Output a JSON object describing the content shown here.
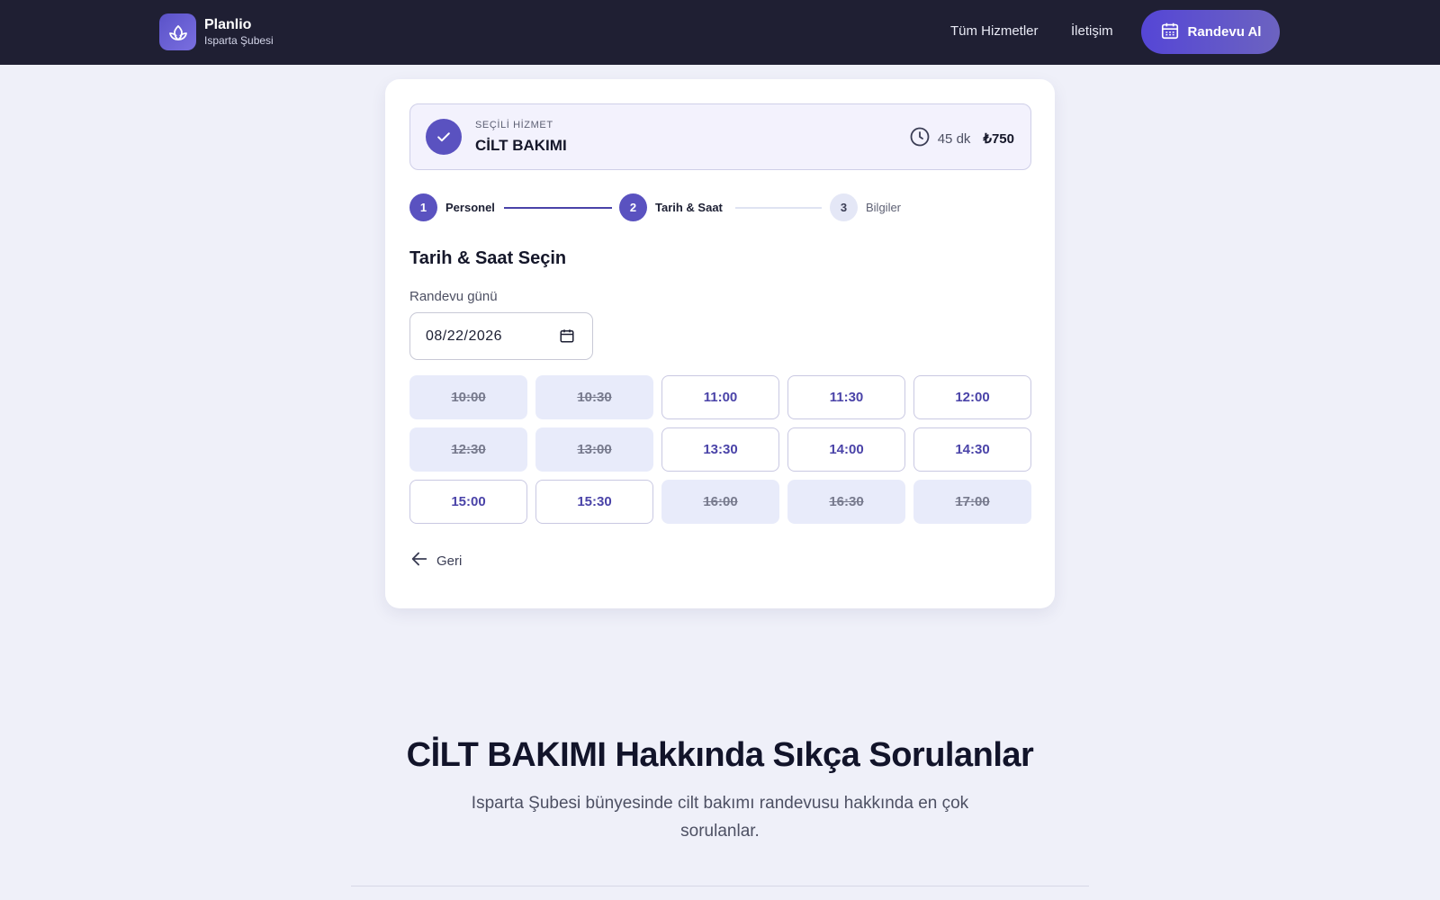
{
  "header": {
    "brand_name": "Planlio",
    "brand_sub": "Isparta Şubesi",
    "nav": [
      "Tüm Hizmetler",
      "İletişim"
    ],
    "cta_label": "Randevu Al"
  },
  "service": {
    "label": "SEÇİLİ HİZMET",
    "name": "CİLT BAKIMI",
    "duration": "45 dk",
    "price": "₺750"
  },
  "steps": [
    {
      "num": "1",
      "label": "Personel",
      "state": "done"
    },
    {
      "num": "2",
      "label": "Tarih & Saat",
      "state": "active"
    },
    {
      "num": "3",
      "label": "Bilgiler",
      "state": "upcoming"
    }
  ],
  "booking": {
    "title": "Tarih & Saat Seçin",
    "date_label": "Randevu günü",
    "date_value": "08/22/2026",
    "back_label": "Geri"
  },
  "slots": [
    {
      "time": "10:00",
      "available": false
    },
    {
      "time": "10:30",
      "available": false
    },
    {
      "time": "11:00",
      "available": true
    },
    {
      "time": "11:30",
      "available": true
    },
    {
      "time": "12:00",
      "available": true
    },
    {
      "time": "12:30",
      "available": false
    },
    {
      "time": "13:00",
      "available": false
    },
    {
      "time": "13:30",
      "available": true
    },
    {
      "time": "14:00",
      "available": true
    },
    {
      "time": "14:30",
      "available": true
    },
    {
      "time": "15:00",
      "available": true
    },
    {
      "time": "15:30",
      "available": true
    },
    {
      "time": "16:00",
      "available": false
    },
    {
      "time": "16:30",
      "available": false
    },
    {
      "time": "17:00",
      "available": false
    }
  ],
  "faq": {
    "title": "CİLT BAKIMI Hakkında Sıkça Sorulanlar",
    "subtitle": "Isparta Şubesi bünyesinde cilt bakımı randevusu hakkında en çok sorulanlar."
  },
  "colors": {
    "header_bg": "#1f1f33",
    "accent": "#5a52c0",
    "page_bg": "#eff0f9",
    "slot_taken_bg": "#e8ebfa"
  },
  "icons": [
    "lotus-icon",
    "calendar-icon",
    "check-icon",
    "clock-icon",
    "date-picker-icon",
    "arrow-left-icon"
  ]
}
